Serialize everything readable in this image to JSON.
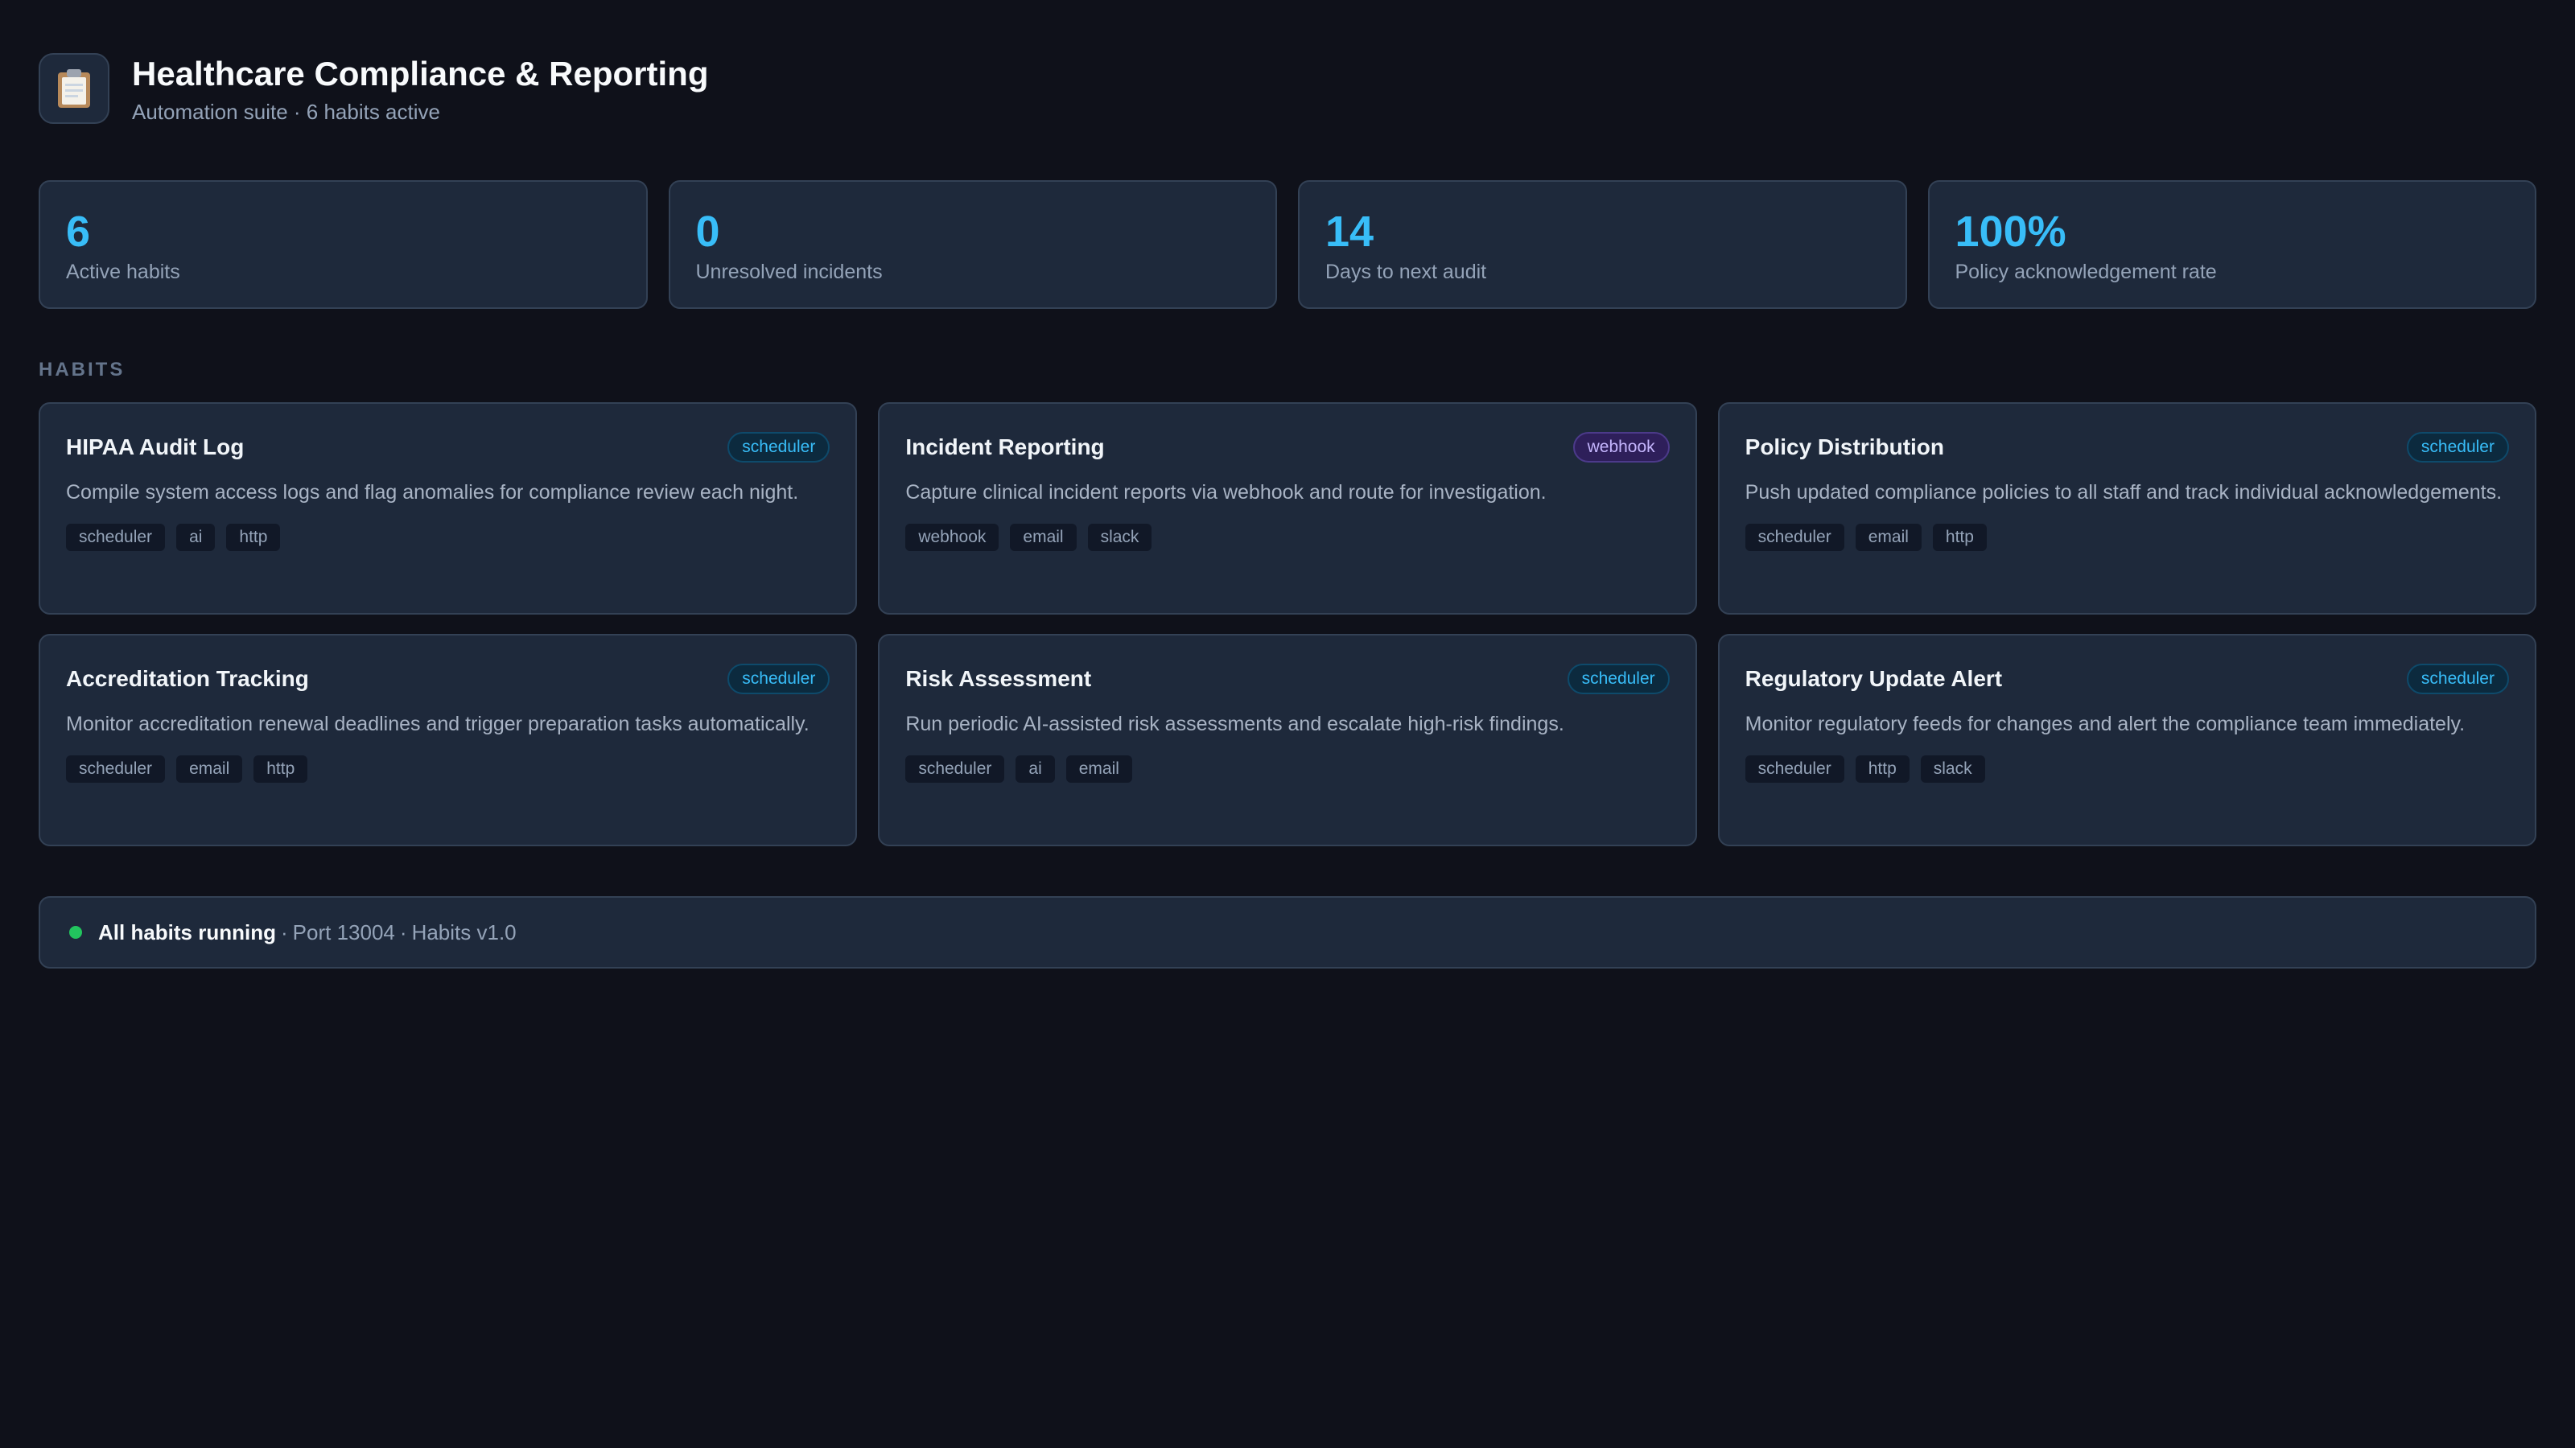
{
  "header": {
    "icon": "clipboard-icon",
    "title": "Healthcare Compliance & Reporting",
    "subtitle": "Automation suite · 6 habits active"
  },
  "stats": [
    {
      "value": "6",
      "label": "Active habits"
    },
    {
      "value": "0",
      "label": "Unresolved incidents"
    },
    {
      "value": "14",
      "label": "Days to next audit"
    },
    {
      "value": "100%",
      "label": "Policy acknowledgement rate"
    }
  ],
  "section": {
    "habits_heading": "HABITS"
  },
  "habits": [
    {
      "name": "HIPAA Audit Log",
      "trigger": "scheduler",
      "description": "Compile system access logs and flag anomalies for compliance review each night.",
      "tags": [
        "scheduler",
        "ai",
        "http"
      ]
    },
    {
      "name": "Incident Reporting",
      "trigger": "webhook",
      "description": "Capture clinical incident reports via webhook and route for investigation.",
      "tags": [
        "webhook",
        "email",
        "slack"
      ]
    },
    {
      "name": "Policy Distribution",
      "trigger": "scheduler",
      "description": "Push updated compliance policies to all staff and track individual acknowledgements.",
      "tags": [
        "scheduler",
        "email",
        "http"
      ]
    },
    {
      "name": "Accreditation Tracking",
      "trigger": "scheduler",
      "description": "Monitor accreditation renewal deadlines and trigger preparation tasks automatically.",
      "tags": [
        "scheduler",
        "email",
        "http"
      ]
    },
    {
      "name": "Risk Assessment",
      "trigger": "scheduler",
      "description": "Run periodic AI-assisted risk assessments and escalate high-risk findings.",
      "tags": [
        "scheduler",
        "ai",
        "email"
      ]
    },
    {
      "name": "Regulatory Update Alert",
      "trigger": "scheduler",
      "description": "Monitor regulatory feeds for changes and alert the compliance team immediately.",
      "tags": [
        "scheduler",
        "http",
        "slack"
      ]
    }
  ],
  "status": {
    "indicator_color": "#22c55e",
    "label": "All habits running",
    "port": "Port 13004",
    "version": "Habits v1.0"
  }
}
